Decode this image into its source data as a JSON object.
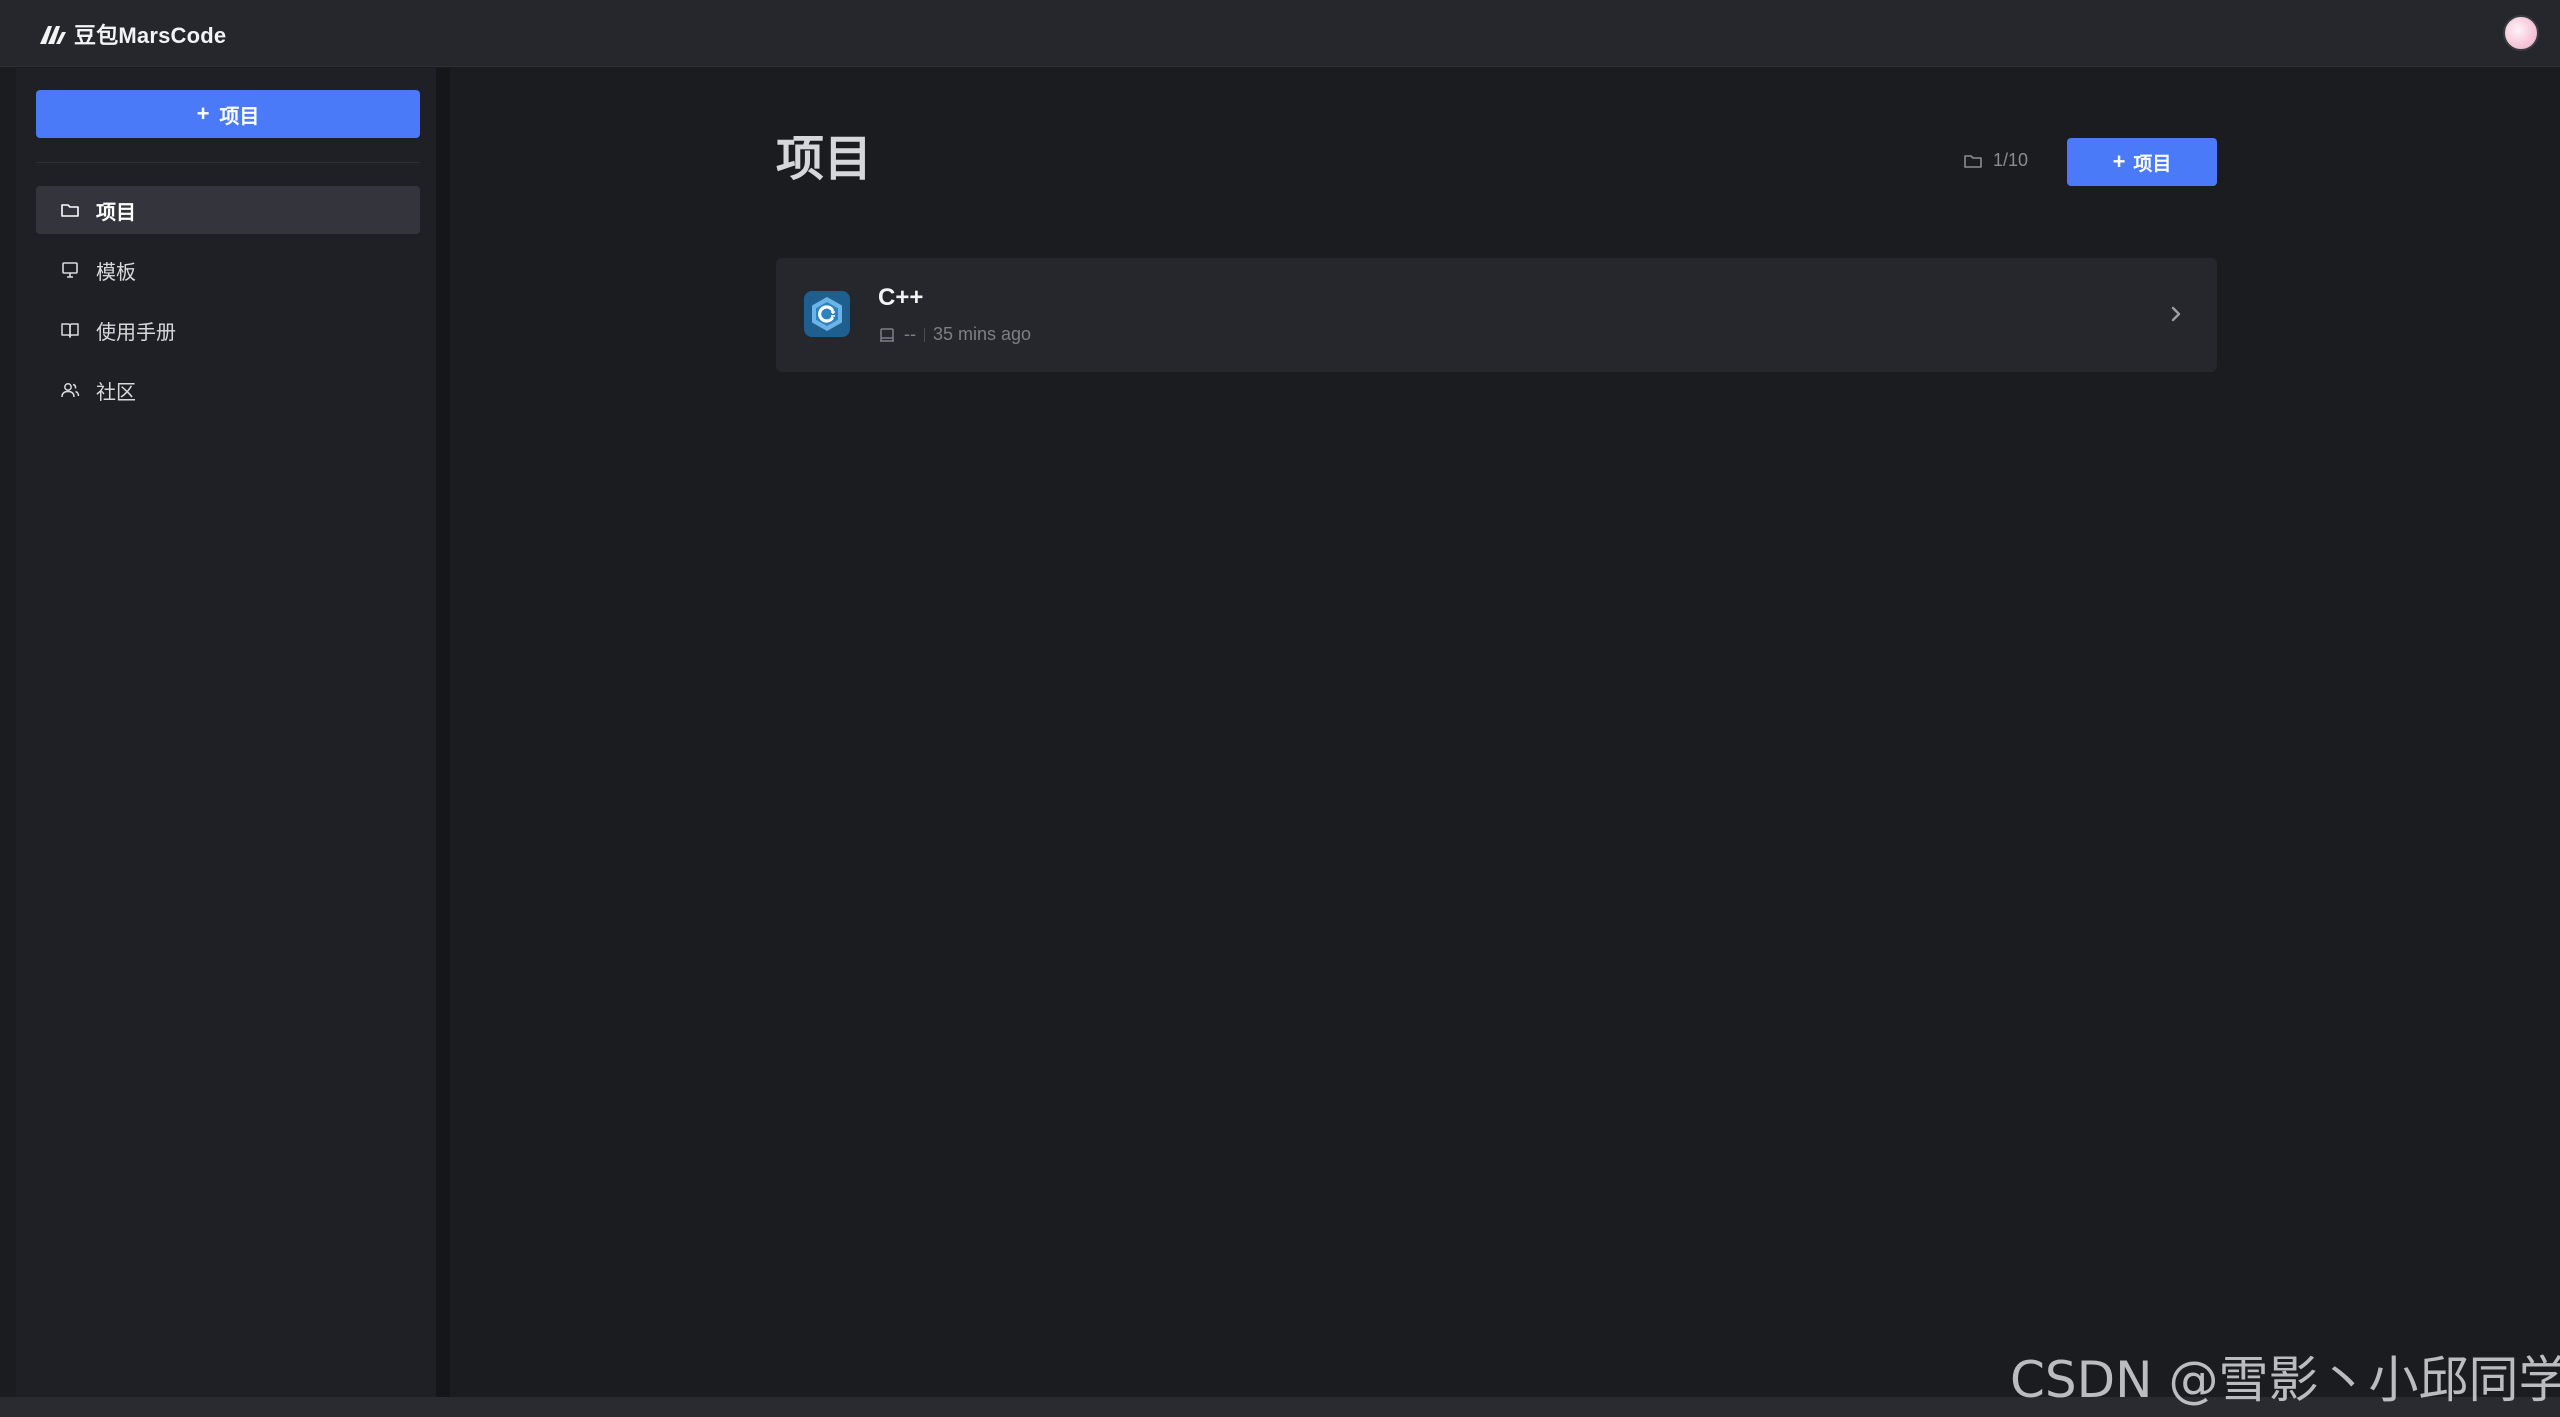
{
  "app": {
    "logo_text": "豆包MarsCode"
  },
  "sidebar": {
    "new_button_label": "项目",
    "items": [
      {
        "label": "项目",
        "icon": "folder-icon",
        "active": true
      },
      {
        "label": "模板",
        "icon": "monitor-icon",
        "active": false
      },
      {
        "label": "使用手册",
        "icon": "book-icon",
        "active": false
      },
      {
        "label": "社区",
        "icon": "users-icon",
        "active": false
      }
    ]
  },
  "main": {
    "title": "项目",
    "quota": "1/10",
    "new_button_label": "项目",
    "projects": [
      {
        "name": "C++",
        "icon": "cpp-icon",
        "machine": "--",
        "updated": "35 mins ago"
      }
    ]
  },
  "watermark": "CSDN @雪影丶小邱同学",
  "colors": {
    "accent": "#4a7af7",
    "background": "#1b1c20",
    "panel": "#26272c"
  }
}
